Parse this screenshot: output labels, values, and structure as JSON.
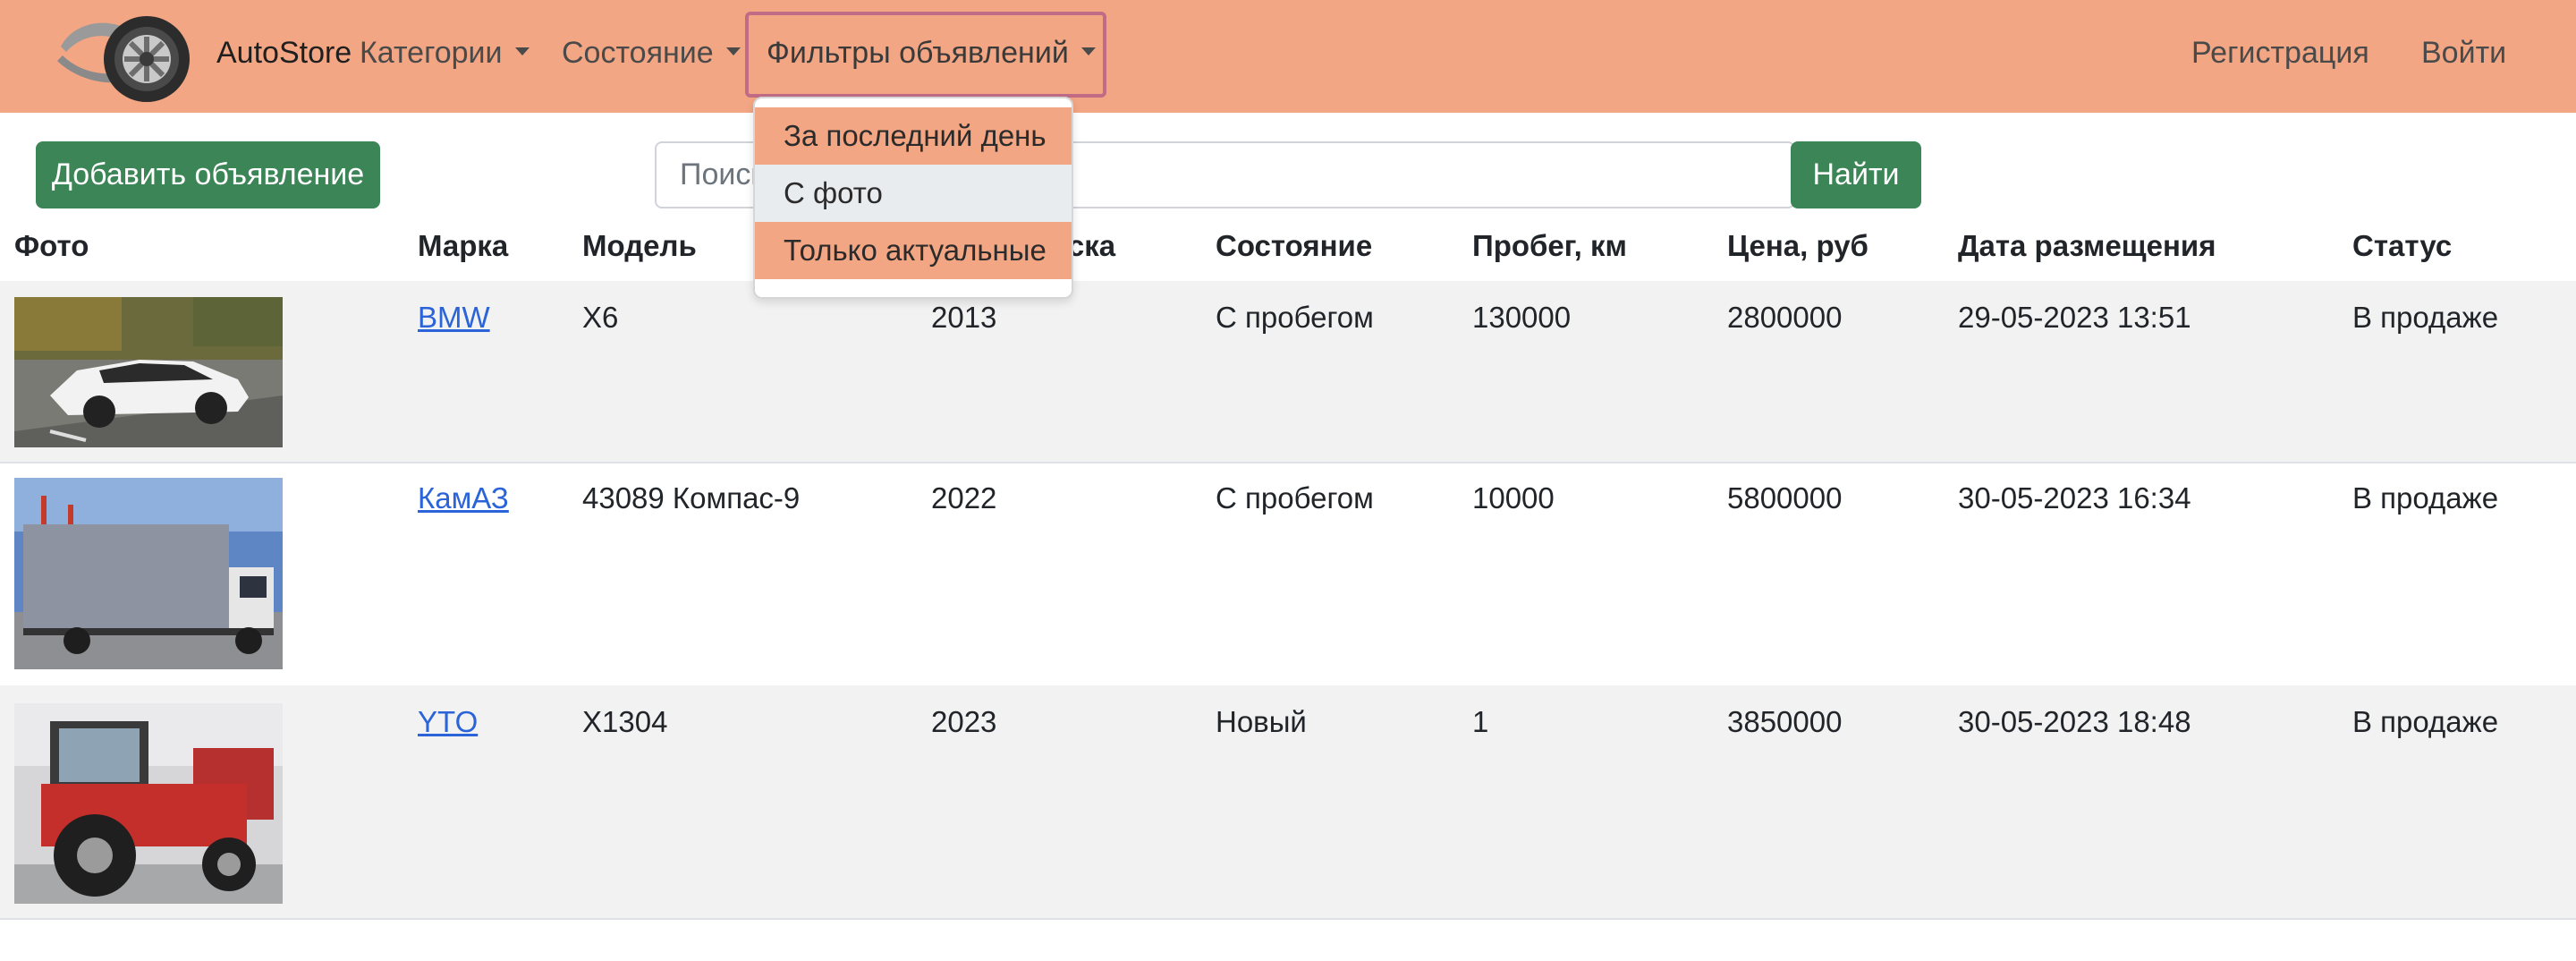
{
  "navbar": {
    "brand": "AutoStore",
    "menus": [
      {
        "label": "Категории"
      },
      {
        "label": "Состояние"
      },
      {
        "label": "Фильтры объявлений"
      }
    ],
    "right": {
      "register": "Регистрация",
      "login": "Войти"
    },
    "bg_color": "#f3a683"
  },
  "filters_dropdown": {
    "items": [
      "За последний день",
      "С фото",
      "Только актуальные"
    ],
    "hovered_item": "С фото"
  },
  "actions": {
    "add_label": "Добавить объявление",
    "search_placeholder": "Поиск",
    "search_value": "",
    "find_label": "Найти",
    "button_color": "#3c8556"
  },
  "table": {
    "headers": [
      "Фото",
      "Марка",
      "Модель",
      "Год выпуска",
      "Состояние",
      "Пробег, км",
      "Цена, руб",
      "Дата размещения",
      "Статус"
    ],
    "rows": [
      {
        "photo": "white-bmw-x6-photo",
        "brand": "BMW",
        "model": "X6",
        "year": "2013",
        "condition": "С пробегом",
        "mileage": "130000",
        "price": "2800000",
        "date": "29-05-2023 13:51",
        "status": "В продаже"
      },
      {
        "photo": "kamaz-truck-photo",
        "brand": "КамАЗ",
        "model": "43089 Компас-9",
        "year": "2022",
        "condition": "С пробегом",
        "mileage": "10000",
        "price": "5800000",
        "date": "30-05-2023 16:34",
        "status": "В продаже"
      },
      {
        "photo": "red-tractor-photo",
        "brand": "YTO",
        "model": "X1304",
        "year": "2023",
        "condition": "Новый",
        "mileage": "1",
        "price": "3850000",
        "date": "30-05-2023 18:48",
        "status": "В продаже"
      }
    ]
  }
}
